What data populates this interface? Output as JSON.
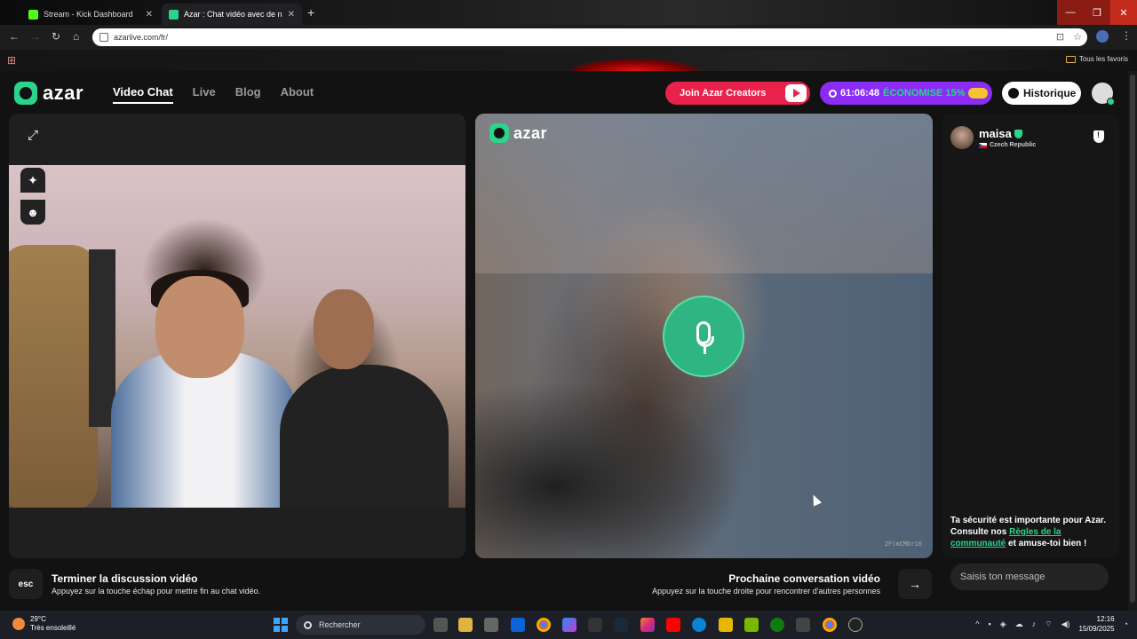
{
  "browser": {
    "tabs": [
      {
        "label": "Stream - Kick Dashboard",
        "color": "#53fc18"
      },
      {
        "label": "Azar : Chat vidéo avec de n",
        "color": "#2bd48a"
      }
    ],
    "new_tab_symbol": "+",
    "close_symbol": "✕",
    "url": "azarlive.com/fr/",
    "bookmarks_folder": "Tous les favoris",
    "window_controls": {
      "minimize": "—",
      "maximize": "❐",
      "close": "✕"
    }
  },
  "header": {
    "logo_text": "azar",
    "nav": [
      {
        "label": "Video Chat",
        "active": true
      },
      {
        "label": "Live",
        "active": false
      },
      {
        "label": "Blog",
        "active": false
      },
      {
        "label": "About",
        "active": false
      }
    ],
    "creators_label": "Join Azar Creators",
    "promo": {
      "timer": "61:06:48",
      "discount": "ÉCONOMISE 15%"
    },
    "history_label": "Historique"
  },
  "local_video": {
    "expand_icon": "⤢",
    "sparkle_icon": "✦",
    "face_icon": "☻"
  },
  "remote_video": {
    "logo_text": "azar",
    "session_code": "2FlmCMDr16"
  },
  "chat": {
    "partner": {
      "name": "maisa",
      "country": "Czech Republic"
    },
    "safety_pre": "Ta sécurité est importante pour Azar. Consulte nos ",
    "safety_link": "Règles de la communauté",
    "safety_post": " et amuse-toi bien !",
    "input_placeholder": "Saisis ton message"
  },
  "controls": {
    "esc_key": "esc",
    "end_title": "Terminer la discussion vidéo",
    "end_sub": "Appuyez sur la touche échap pour mettre fin au chat vidéo.",
    "next_title": "Prochaine conversation vidéo",
    "next_sub": "Appuyez sur la touche droite pour rencontrer d'autres personnes",
    "next_arrow": "→"
  },
  "taskbar": {
    "weather_temp": "29°C",
    "weather_desc": "Très ensoleillé",
    "search_label": "Rechercher",
    "time": "12:16",
    "date": "15/09/2025",
    "tray_chevron": "^"
  },
  "colors": {
    "accent": "#2bd48a",
    "creators": "#e8224a",
    "promo": "#8b2cf5"
  }
}
